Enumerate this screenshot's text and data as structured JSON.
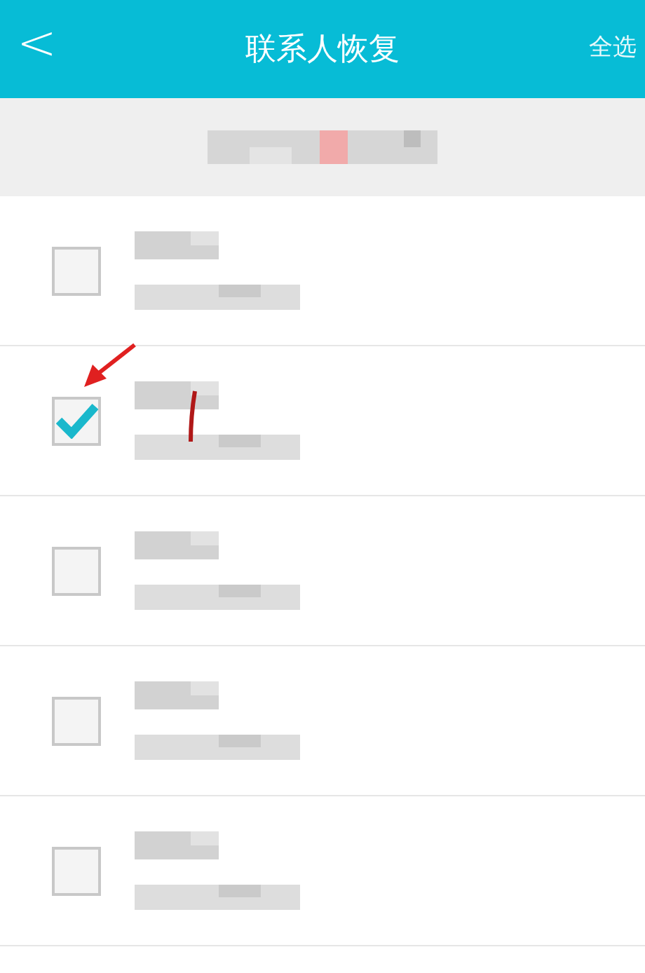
{
  "header": {
    "back": "<",
    "title": "联系人恢复",
    "action": "全选"
  },
  "contacts": [
    {
      "checked": false
    },
    {
      "checked": true
    },
    {
      "checked": false
    },
    {
      "checked": false
    },
    {
      "checked": false
    }
  ]
}
